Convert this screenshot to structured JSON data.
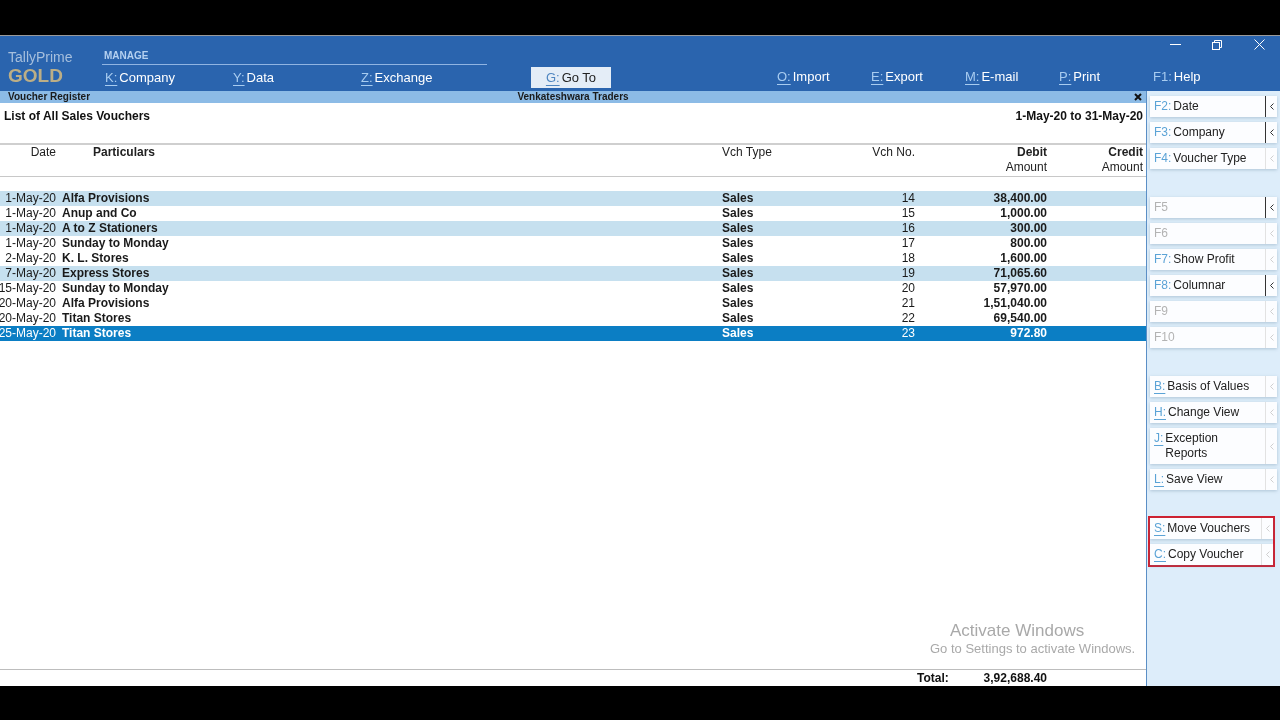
{
  "header": {
    "brand": {
      "product": "TallyPrime",
      "edition": "GOLD"
    },
    "menu_group": {
      "heading": "MANAGE",
      "items": [
        {
          "key": "K:",
          "label": "Company",
          "kind": "letter"
        },
        {
          "key": "Y:",
          "label": "Data",
          "kind": "letter"
        },
        {
          "key": "Z:",
          "label": "Exchange",
          "kind": "letter"
        }
      ]
    },
    "goto_button": {
      "key": "G:",
      "label": "Go To",
      "kind": "letter"
    },
    "menu_items": [
      {
        "key": "O:",
        "label": "Import",
        "kind": "letter"
      },
      {
        "key": "E:",
        "label": "Export",
        "kind": "letter"
      },
      {
        "key": "M:",
        "label": "E-mail",
        "kind": "letter"
      },
      {
        "key": "P:",
        "label": "Print",
        "kind": "letter"
      },
      {
        "key": "F1:",
        "label": "Help",
        "kind": "function"
      }
    ]
  },
  "report": {
    "title_bar": {
      "title": "Voucher Register",
      "company": "Venkateshwara Traders"
    },
    "heading": "List of All Sales Vouchers",
    "period": "1-May-20 to 31-May-20",
    "columns": [
      {
        "label": "Date"
      },
      {
        "label": "Particulars"
      },
      {
        "label": "Vch Type"
      },
      {
        "label": "Vch No."
      },
      {
        "label": "Debit",
        "sublabel": "Amount"
      },
      {
        "label": "Credit",
        "sublabel": "Amount"
      }
    ],
    "rows": [
      {
        "date": "1-May-20",
        "particulars": "Alfa Provisions",
        "vch_type": "Sales",
        "vch_no": "14",
        "debit": "38,400.00",
        "shaded": true,
        "selected": false
      },
      {
        "date": "1-May-20",
        "particulars": "Anup and Co",
        "vch_type": "Sales",
        "vch_no": "15",
        "debit": "1,000.00",
        "shaded": false,
        "selected": false
      },
      {
        "date": "1-May-20",
        "particulars": "A to Z Stationers",
        "vch_type": "Sales",
        "vch_no": "16",
        "debit": "300.00",
        "shaded": true,
        "selected": false
      },
      {
        "date": "1-May-20",
        "particulars": "Sunday to Monday",
        "vch_type": "Sales",
        "vch_no": "17",
        "debit": "800.00",
        "shaded": false,
        "selected": false
      },
      {
        "date": "2-May-20",
        "particulars": "K. L. Stores",
        "vch_type": "Sales",
        "vch_no": "18",
        "debit": "1,600.00",
        "shaded": false,
        "selected": false
      },
      {
        "date": "7-May-20",
        "particulars": "Express Stores",
        "vch_type": "Sales",
        "vch_no": "19",
        "debit": "71,065.60",
        "shaded": true,
        "selected": false
      },
      {
        "date": "15-May-20",
        "particulars": "Sunday to Monday",
        "vch_type": "Sales",
        "vch_no": "20",
        "debit": "57,970.00",
        "shaded": false,
        "selected": false
      },
      {
        "date": "20-May-20",
        "particulars": "Alfa Provisions",
        "vch_type": "Sales",
        "vch_no": "21",
        "debit": "1,51,040.00",
        "shaded": false,
        "selected": false
      },
      {
        "date": "20-May-20",
        "particulars": "Titan Stores",
        "vch_type": "Sales",
        "vch_no": "22",
        "debit": "69,540.00",
        "shaded": false,
        "selected": false
      },
      {
        "date": "25-May-20",
        "particulars": "Titan Stores",
        "vch_type": "Sales",
        "vch_no": "23",
        "debit": "972.80",
        "shaded": false,
        "selected": true
      }
    ],
    "total": {
      "label": "Total:",
      "debit": "3,92,688.40"
    }
  },
  "sidebar": {
    "groups": [
      {
        "outlined": false,
        "items": [
          {
            "key": "F2:",
            "label": "Date",
            "kind": "function",
            "disabled": false,
            "chevron_active": true
          },
          {
            "key": "F3:",
            "label": "Company",
            "kind": "function",
            "disabled": false,
            "chevron_active": true
          },
          {
            "key": "F4:",
            "label": "Voucher Type",
            "kind": "function",
            "disabled": false,
            "chevron_active": false
          }
        ]
      },
      {
        "outlined": false,
        "items": [
          {
            "key": "F5",
            "kind": "function",
            "disabled": true,
            "chevron_active": true
          },
          {
            "key": "F6",
            "kind": "function",
            "disabled": true,
            "chevron_active": false
          },
          {
            "key": "F7:",
            "label": "Show Profit",
            "kind": "function",
            "disabled": false,
            "chevron_active": false
          },
          {
            "key": "F8:",
            "label": "Columnar",
            "kind": "function",
            "disabled": false,
            "chevron_active": true
          },
          {
            "key": "F9",
            "kind": "function",
            "disabled": true,
            "chevron_active": false
          },
          {
            "key": "F10",
            "kind": "function",
            "disabled": true,
            "chevron_active": false
          }
        ]
      },
      {
        "outlined": false,
        "items": [
          {
            "key": "B:",
            "label": "Basis of Values",
            "kind": "letter",
            "disabled": false,
            "chevron_active": false
          },
          {
            "key": "H:",
            "label": "Change View",
            "kind": "letter",
            "disabled": false,
            "chevron_active": false
          },
          {
            "key": "J:",
            "label": "Exception Reports",
            "kind": "letter",
            "disabled": false,
            "chevron_active": false
          },
          {
            "key": "L:",
            "label": "Save View",
            "kind": "letter",
            "disabled": false,
            "chevron_active": false
          }
        ]
      },
      {
        "outlined": true,
        "items": [
          {
            "key": "S:",
            "label": "Move Vouchers",
            "kind": "letter",
            "disabled": false,
            "chevron_active": false
          },
          {
            "key": "C:",
            "label": "Copy Voucher",
            "kind": "letter",
            "disabled": false,
            "chevron_active": false
          }
        ]
      }
    ]
  },
  "os_notice": {
    "title": "Activate Windows",
    "text": "Go to Settings to activate Windows."
  }
}
